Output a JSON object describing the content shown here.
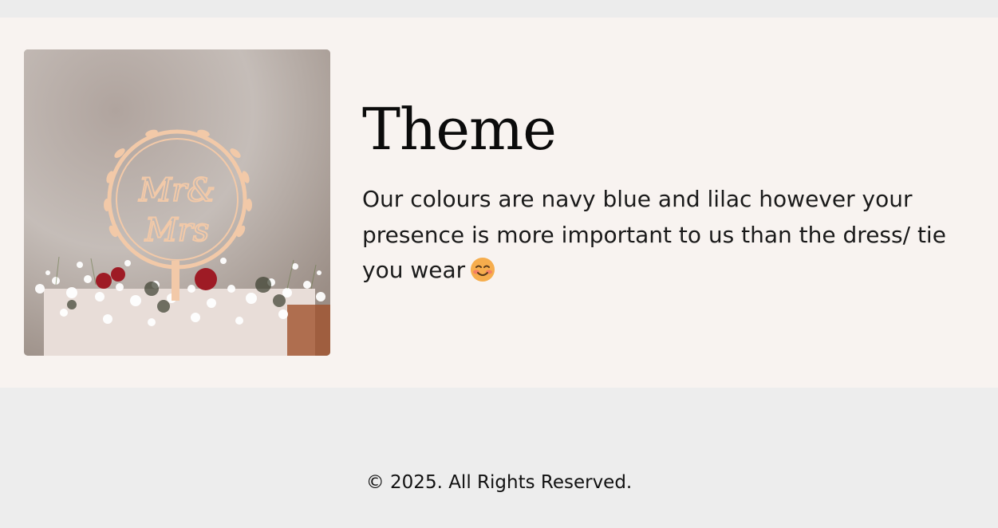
{
  "theme": {
    "title": "Theme",
    "body": "Our colours are navy blue and lilac however your presence is more important to us than the dress/ tie you wear",
    "emoji": "smiling-face-icon",
    "photo": {
      "description_icon": "cake-topper-photo",
      "topper_line1": "Mr&",
      "topper_line2": "Mrs"
    }
  },
  "footer": {
    "copyright": "© 2025. All Rights Reserved."
  },
  "colors": {
    "page_bg": "#ededed",
    "section_bg": "#f8f3f0",
    "text": "#111111"
  }
}
